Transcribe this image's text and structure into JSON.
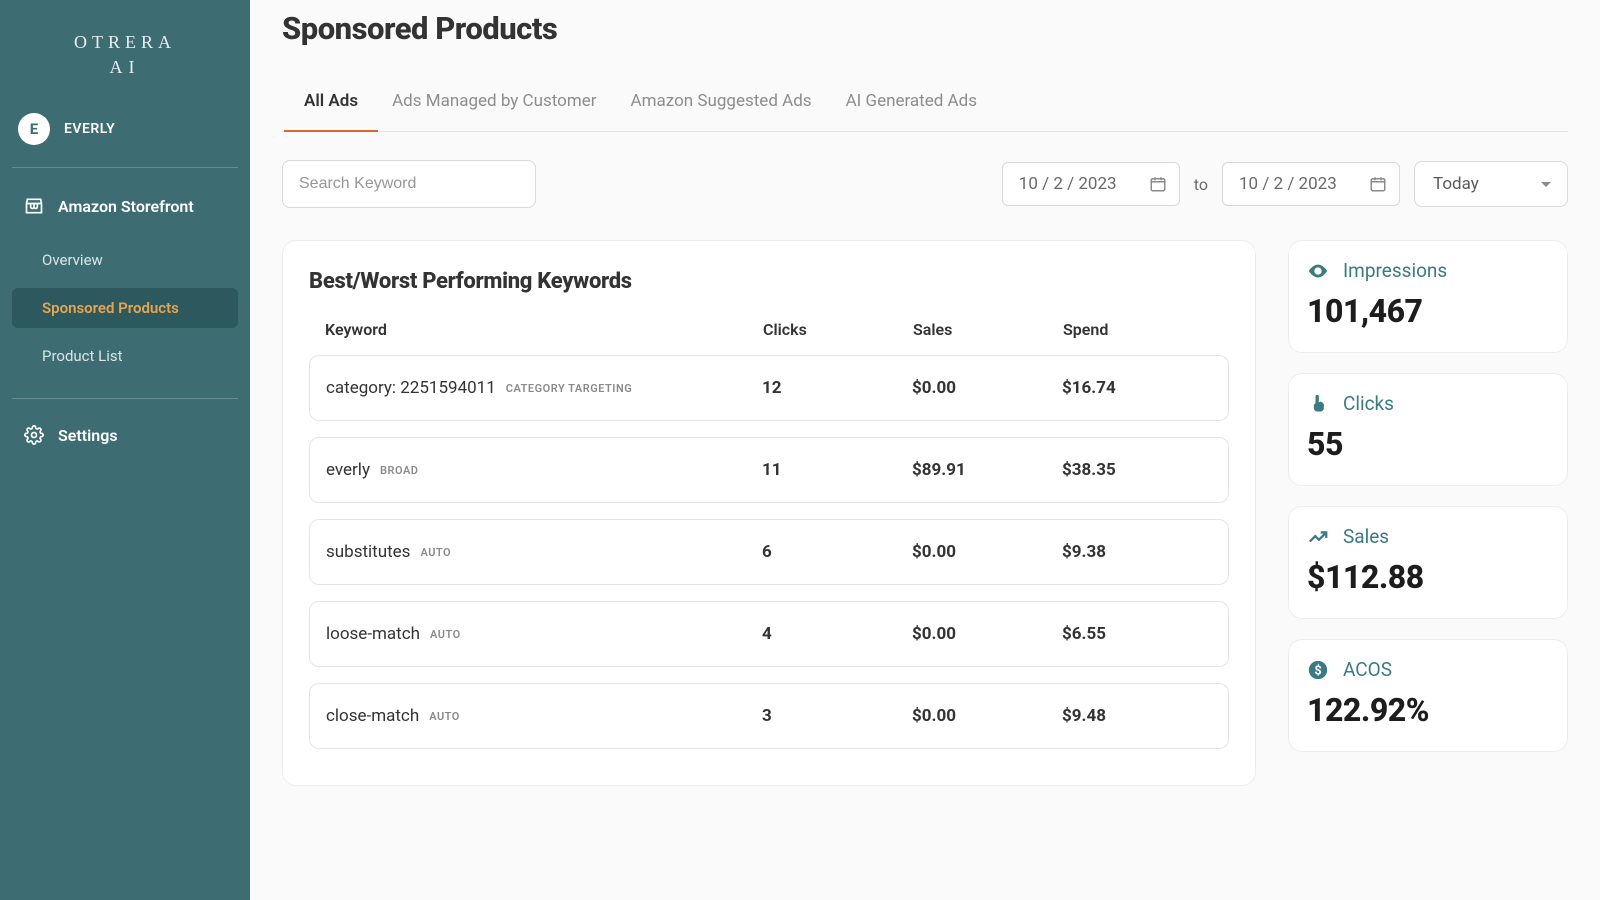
{
  "brand": {
    "line1": "OTRERA",
    "line2": "AI"
  },
  "user": {
    "initial": "E",
    "name": "EVERLY"
  },
  "sidebar": {
    "storefront_label": "Amazon Storefront",
    "items": [
      {
        "label": "Overview"
      },
      {
        "label": "Sponsored Products"
      },
      {
        "label": "Product List"
      }
    ],
    "settings_label": "Settings"
  },
  "page": {
    "title": "Sponsored Products"
  },
  "tabs": [
    {
      "label": "All Ads",
      "active": true
    },
    {
      "label": "Ads Managed by Customer"
    },
    {
      "label": "Amazon Suggested Ads"
    },
    {
      "label": "AI Generated Ads"
    }
  ],
  "filters": {
    "search_placeholder": "Search Keyword",
    "date_from": "10 / 2 / 2023",
    "to_label": "to",
    "date_to": "10 / 2 / 2023",
    "range_label": "Today"
  },
  "keyword_panel": {
    "title": "Best/Worst Performing Keywords",
    "columns": {
      "keyword": "Keyword",
      "clicks": "Clicks",
      "sales": "Sales",
      "spend": "Spend"
    },
    "rows": [
      {
        "keyword": "category: 2251594011",
        "tag": "CATEGORY TARGETING",
        "clicks": "12",
        "sales": "$0.00",
        "spend": "$16.74"
      },
      {
        "keyword": "everly",
        "tag": "BROAD",
        "clicks": "11",
        "sales": "$89.91",
        "spend": "$38.35"
      },
      {
        "keyword": "substitutes",
        "tag": "AUTO",
        "clicks": "6",
        "sales": "$0.00",
        "spend": "$9.38"
      },
      {
        "keyword": "loose-match",
        "tag": "AUTO",
        "clicks": "4",
        "sales": "$0.00",
        "spend": "$6.55"
      },
      {
        "keyword": "close-match",
        "tag": "AUTO",
        "clicks": "3",
        "sales": "$0.00",
        "spend": "$9.48"
      }
    ]
  },
  "metrics": {
    "impressions": {
      "label": "Impressions",
      "value": "101,467"
    },
    "clicks": {
      "label": "Clicks",
      "value": "55"
    },
    "sales": {
      "label": "Sales",
      "value": "$112.88"
    },
    "acos": {
      "label": "ACOS",
      "value": "122.92%"
    }
  },
  "colors": {
    "accent": "#3d6d73",
    "highlight": "#d86b2a",
    "teal_text": "#3a7b83"
  }
}
